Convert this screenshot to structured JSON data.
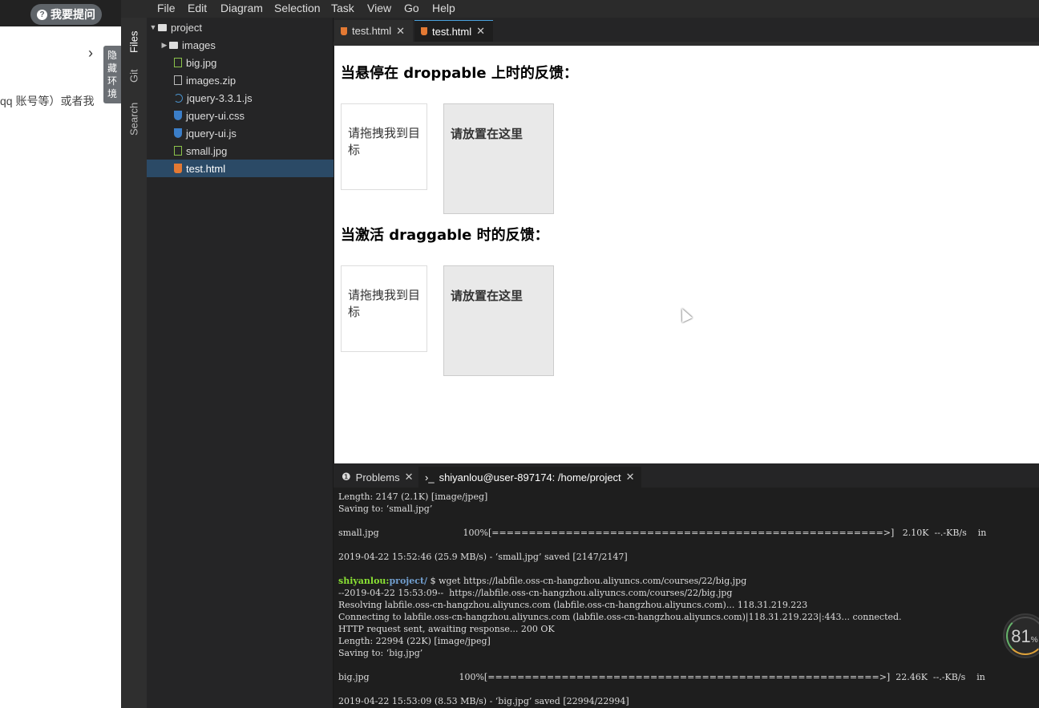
{
  "left_page": {
    "ask_button": "我要提问",
    "snippet": "qq 账号等）或者我",
    "hide_env": "隐藏环境"
  },
  "menubar": [
    "File",
    "Edit",
    "Diagram",
    "Selection",
    "Task",
    "View",
    "Go",
    "Help"
  ],
  "activity_bar": [
    "Files",
    "Git",
    "Search"
  ],
  "explorer": {
    "root": "project",
    "items": [
      {
        "label": "images",
        "type": "folder"
      },
      {
        "label": "big.jpg",
        "type": "img"
      },
      {
        "label": "images.zip",
        "type": "zip"
      },
      {
        "label": "jquery-3.3.1.js",
        "type": "js"
      },
      {
        "label": "jquery-ui.css",
        "type": "css"
      },
      {
        "label": "jquery-ui.js",
        "type": "css"
      },
      {
        "label": "small.jpg",
        "type": "img"
      },
      {
        "label": "test.html",
        "type": "html",
        "selected": true
      }
    ]
  },
  "editor_tabs": [
    {
      "label": "test.html",
      "active": false
    },
    {
      "label": "test.html",
      "active": true
    }
  ],
  "preview": {
    "section1_title": "当悬停在 droppable 上时的反馈：",
    "section2_title": "当激活 draggable 时的反馈：",
    "drag_text": "请拖拽我到目标",
    "drop_text": "请放置在这里"
  },
  "panel_tabs": {
    "problems": "Problems",
    "terminal": "shiyanlou@user-897174: /home/project"
  },
  "terminal": {
    "lines_before_prompt": [
      "Length: 2147 (2.1K) [image/jpeg]",
      "Saving to: ‘small.jpg’",
      "",
      "small.jpg                              100%[=====================================================>]   2.10K  --.-KB/s    in",
      "",
      "2019-04-22 15:52:46 (25.9 MB/s) - ‘small.jpg’ saved [2147/2147]",
      ""
    ],
    "prompt_user": "shiyanlou:",
    "prompt_path": "project/",
    "prompt_cmd": " $ wget https://labfile.oss-cn-hangzhou.aliyuncs.com/courses/22/big.jpg",
    "lines_after_prompt": [
      "--2019-04-22 15:53:09--  https://labfile.oss-cn-hangzhou.aliyuncs.com/courses/22/big.jpg",
      "Resolving labfile.oss-cn-hangzhou.aliyuncs.com (labfile.oss-cn-hangzhou.aliyuncs.com)... 118.31.219.223",
      "Connecting to labfile.oss-cn-hangzhou.aliyuncs.com (labfile.oss-cn-hangzhou.aliyuncs.com)|118.31.219.223|:443... connected.",
      "HTTP request sent, awaiting response... 200 OK",
      "Length: 22994 (22K) [image/jpeg]",
      "Saving to: ‘big.jpg’",
      "",
      "big.jpg                                100%[=====================================================>]  22.46K  --.-KB/s    in",
      "",
      "2019-04-22 15:53:09 (8.53 MB/s) - ‘big.jpg’ saved [22994/22994]"
    ]
  },
  "gauge": {
    "value": "81",
    "unit": "%"
  }
}
